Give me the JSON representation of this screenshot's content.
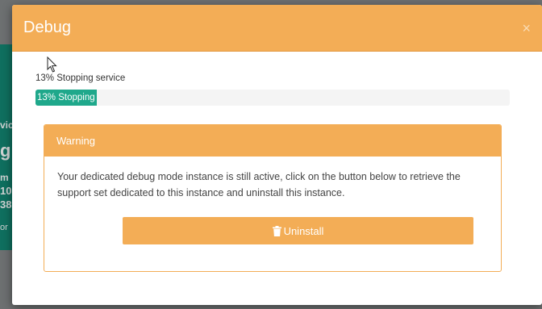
{
  "background": {
    "fragments": [
      "vic",
      "g",
      "m",
      "10",
      "38",
      "or"
    ]
  },
  "modal": {
    "title": "Debug",
    "close_glyph": "×",
    "status_text": "13% Stopping service",
    "progress_label": "13% Stopping",
    "progress_value": 0.13,
    "panel": {
      "heading": "Warning",
      "text": "Your dedicated debug mode instance is still active, click on the button below to retrieve the support set dedicated to this instance and uninstall this instance.",
      "button_label": "Uninstall",
      "button_icon": "trash-icon"
    }
  },
  "colors": {
    "header": "#f3ad56",
    "progress": "#1fa88b",
    "background_teal": "#0f6f5f"
  }
}
